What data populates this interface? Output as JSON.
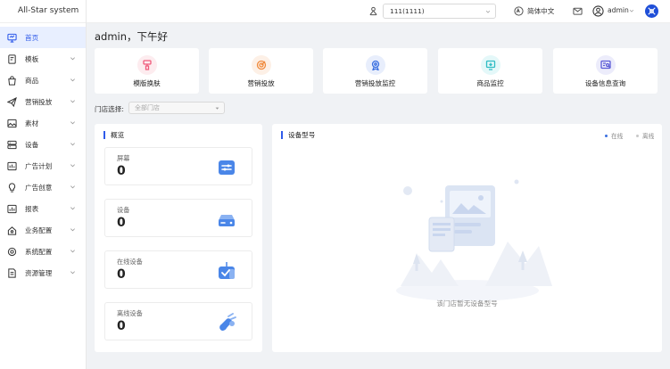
{
  "app": {
    "title": "All-Star system"
  },
  "sidebar": {
    "items": [
      {
        "label": "首页",
        "icon": "monitor-icon",
        "active": true,
        "chevron": false
      },
      {
        "label": "模板",
        "icon": "template-icon",
        "active": false,
        "chevron": true
      },
      {
        "label": "商品",
        "icon": "goods-icon",
        "active": false,
        "chevron": true
      },
      {
        "label": "营销投放",
        "icon": "send-icon",
        "active": false,
        "chevron": true
      },
      {
        "label": "素材",
        "icon": "image-icon",
        "active": false,
        "chevron": true
      },
      {
        "label": "设备",
        "icon": "device-icon",
        "active": false,
        "chevron": true
      },
      {
        "label": "广告计划",
        "icon": "ad-plan-icon",
        "active": false,
        "chevron": true
      },
      {
        "label": "广告创意",
        "icon": "bulb-icon",
        "active": false,
        "chevron": true
      },
      {
        "label": "报表",
        "icon": "chart-icon",
        "active": false,
        "chevron": true
      },
      {
        "label": "业务配置",
        "icon": "business-icon",
        "active": false,
        "chevron": true
      },
      {
        "label": "系统配置",
        "icon": "settings-icon",
        "active": false,
        "chevron": true
      },
      {
        "label": "资源管理",
        "icon": "resource-icon",
        "active": false,
        "chevron": true
      }
    ]
  },
  "header": {
    "store_value": "111(1111)",
    "language": "简体中文",
    "user": "admin"
  },
  "main": {
    "greeting": "admin，下午好",
    "quick_links": [
      {
        "label": "模版换肤",
        "icon": "brush-icon",
        "color": "#f05a7a",
        "bg": "#fdecef"
      },
      {
        "label": "营销投放",
        "icon": "target-icon",
        "color": "#f08a3c",
        "bg": "#fdf0e6"
      },
      {
        "label": "营销投放监控",
        "icon": "monitor-badge-icon",
        "color": "#3a6fe0",
        "bg": "#e8eefc"
      },
      {
        "label": "商品监控",
        "icon": "goods-monitor-icon",
        "color": "#2ebcc4",
        "bg": "#e4f8f9"
      },
      {
        "label": "设备信息查询",
        "icon": "device-search-icon",
        "color": "#5b5bd6",
        "bg": "#ececfb"
      }
    ],
    "store_filter": {
      "label": "门店选择:",
      "placeholder": "全部门店"
    },
    "overview": {
      "title": "概览",
      "stats": [
        {
          "label": "屏幕",
          "value": "0",
          "icon": "screen-icon"
        },
        {
          "label": "设备",
          "value": "0",
          "icon": "device-box-icon"
        },
        {
          "label": "在线设备",
          "value": "0",
          "icon": "online-device-icon"
        },
        {
          "label": "离线设备",
          "value": "0",
          "icon": "offline-device-icon"
        }
      ]
    },
    "device_model": {
      "title": "设备型号",
      "legend": [
        {
          "label": "在线",
          "color": "#3a6fe0"
        },
        {
          "label": "离线",
          "color": "#c8c8c8"
        }
      ],
      "empty_text": "该门店暂无设备型号"
    }
  },
  "colors": {
    "accent": "#2f5bea",
    "stat_icon": "#4a86e8"
  }
}
